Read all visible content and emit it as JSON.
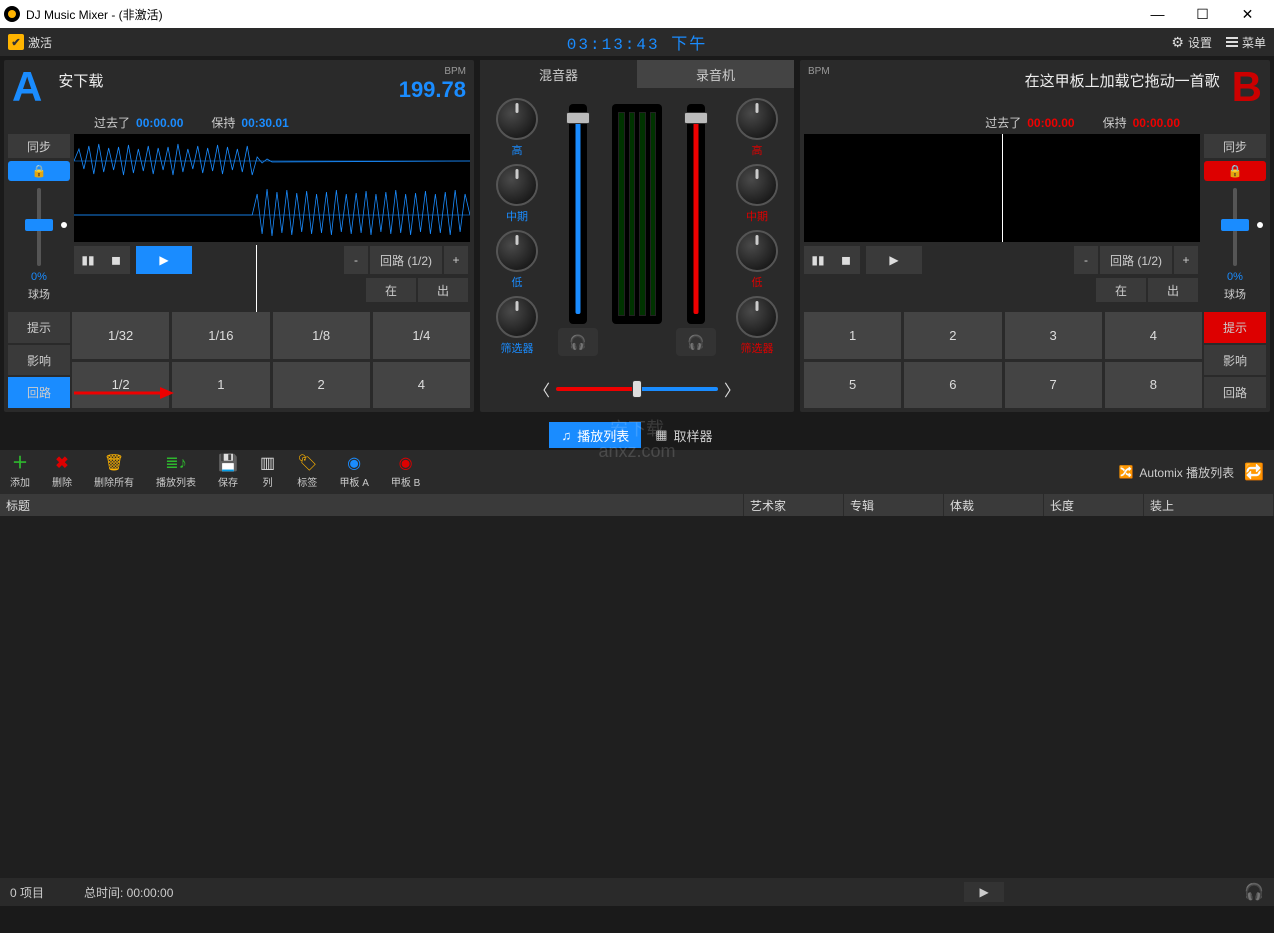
{
  "window": {
    "title": "DJ Music Mixer - (非激活)"
  },
  "toolbar": {
    "activate": "激活",
    "clock": "03:13:43 下午",
    "settings": "设置",
    "menu": "菜单"
  },
  "deckA": {
    "letter": "A",
    "title": "安下载",
    "bpm_label": "BPM",
    "bpm": "199.78",
    "elapsed_label": "过去了",
    "elapsed": "00:00.00",
    "remain_label": "保持",
    "remain": "00:30.01",
    "sync": "同步",
    "pct": "0%",
    "pct_label": "球场",
    "loop_label": "回路 (1/2)",
    "in": "在",
    "out": "出",
    "side_btns": [
      "提示",
      "影响",
      "回路"
    ],
    "pads": [
      "1/32",
      "1/16",
      "1/8",
      "1/4",
      "1/2",
      "1",
      "2",
      "4"
    ]
  },
  "deckB": {
    "letter": "B",
    "title": "在这甲板上加载它拖动一首歌",
    "bpm_label": "BPM",
    "bpm": "",
    "elapsed_label": "过去了",
    "elapsed": "00:00.00",
    "remain_label": "保持",
    "remain": "00:00.00",
    "sync": "同步",
    "pct": "0%",
    "pct_label": "球场",
    "loop_label": "回路 (1/2)",
    "in": "在",
    "out": "出",
    "side_btns": [
      "提示",
      "影响",
      "回路"
    ],
    "pads": [
      "1",
      "2",
      "3",
      "4",
      "5",
      "6",
      "7",
      "8"
    ]
  },
  "mixer": {
    "tabs": [
      "混音器",
      "录音机"
    ],
    "knob_labels": [
      "高",
      "中期",
      "低",
      "筛选器"
    ]
  },
  "subtabs": {
    "playlist": "播放列表",
    "sampler": "取样器"
  },
  "pl_toolbar": {
    "add": "添加",
    "delete": "删除",
    "delete_all": "删除所有",
    "playlist": "播放列表",
    "save": "保存",
    "columns": "列",
    "tag": "标签",
    "deckA": "甲板 A",
    "deckB": "甲板 B",
    "automix": "Automix 播放列表"
  },
  "pl_columns": {
    "title": "标题",
    "artist": "艺术家",
    "album": "专辑",
    "genre": "体裁",
    "length": "长度",
    "load": "装上"
  },
  "status": {
    "items": "0 项目",
    "total": "总时间: 00:00:00"
  }
}
